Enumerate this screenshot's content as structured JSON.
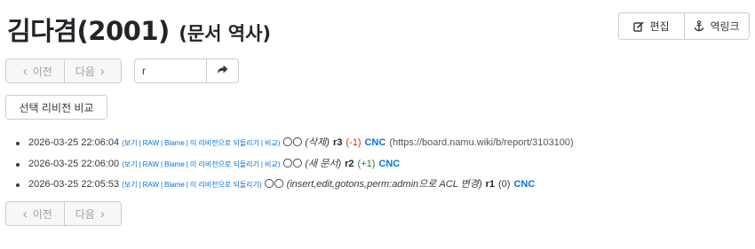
{
  "header": {
    "title": "김다겸(2001)",
    "subtitle": "(문서 역사)",
    "edit_label": "편집",
    "backlinks_label": "역링크"
  },
  "pager": {
    "prev_label": "이전",
    "next_label": "다음"
  },
  "search": {
    "value": "r"
  },
  "compare_label": "선택 리비전 비교",
  "revisions": [
    {
      "date": "2026-03-25 22:06:04",
      "links": [
        "보기",
        "RAW",
        "Blame",
        "이 리비전으로 되돌리기",
        "비교"
      ],
      "author": "〇〇",
      "summary": "(삭제)",
      "rev": "r3",
      "count": "(-1)",
      "count_type": "neg",
      "user": "CNC",
      "reason": "(https://board.namu.wiki/b/report/3103100)"
    },
    {
      "date": "2026-03-25 22:06:00",
      "links": [
        "보기",
        "RAW",
        "Blame",
        "이 리비전으로 되돌리기",
        "비교"
      ],
      "author": "〇〇",
      "summary": "(새 문서)",
      "rev": "r2",
      "count": "(+1)",
      "count_type": "pos",
      "user": "CNC",
      "reason": ""
    },
    {
      "date": "2026-03-25 22:05:53",
      "links": [
        "보기",
        "RAW",
        "Blame",
        "이 리비전으로 되돌리기"
      ],
      "author": "〇〇",
      "summary": "(insert,edit,gotons,perm:admin으로 ACL 변경)",
      "rev": "r1",
      "count": "(0)",
      "count_type": "zero",
      "user": "CNC",
      "reason": ""
    }
  ]
}
